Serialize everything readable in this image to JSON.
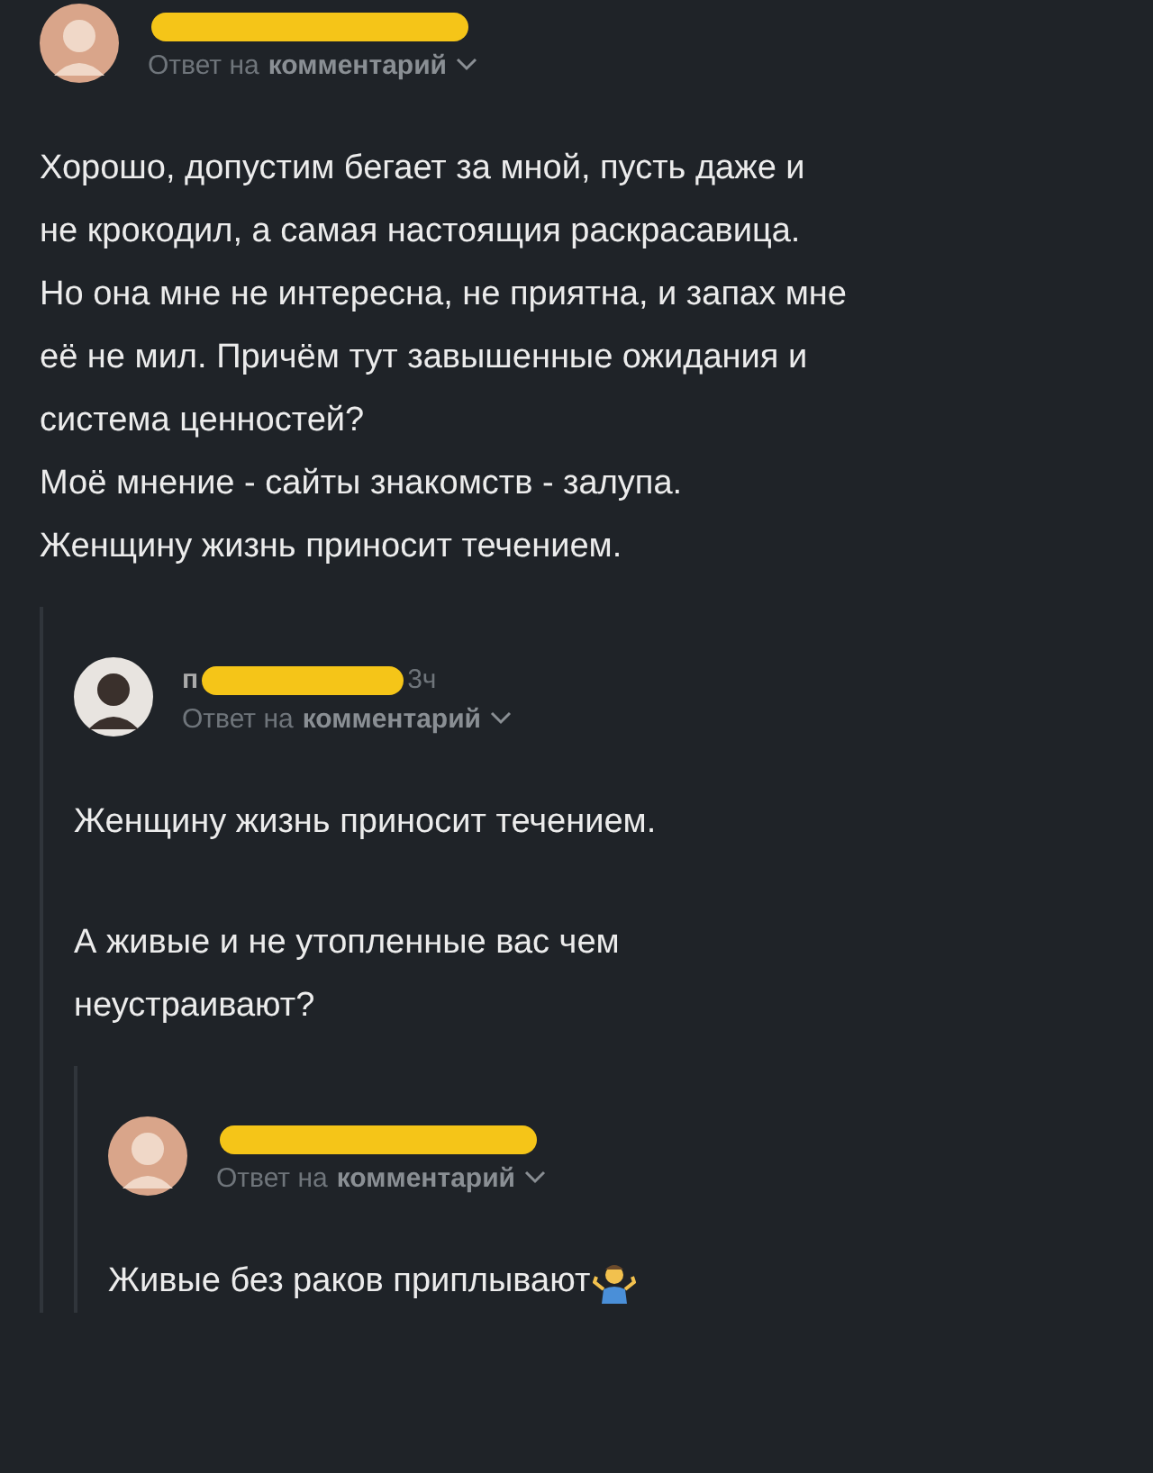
{
  "comments": [
    {
      "reply_prefix": "Ответ на",
      "reply_target": "комментарий",
      "paragraphs": [
        "Хорошо, допустим бегает за мной, пусть даже и\nне крокодил, а самая настоящия раскрасавица.\nНо она мне не интересна, не приятна, и запах мне\neё не мил. Причём тут завышенные ожидания и\nсистема ценностей?\nМоё мнение - сайты знакомств - залупа.\nЖенщину жизнь приносит течением."
      ],
      "children": [
        {
          "author": "п",
          "time": "3ч",
          "reply_prefix": "Ответ на",
          "reply_target": "комментарий",
          "paragraphs": [
            "Женщину жизнь приносит течением.",
            "А живые и не утопленные вас чем\nнеустраивают?"
          ],
          "children": [
            {
              "reply_prefix": "Ответ на",
              "reply_target": "комментарий",
              "paragraphs": [
                "Живые без раков приплывают"
              ]
            }
          ]
        }
      ]
    }
  ]
}
